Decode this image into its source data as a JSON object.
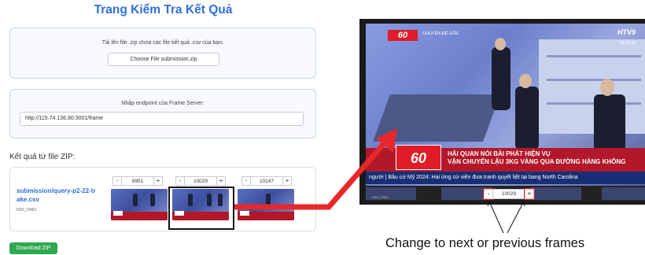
{
  "page": {
    "title": "Trang Kiểm Tra Kết Quả"
  },
  "upload": {
    "label": "Tải lên file .zip chứa các file kết quả .csv của bạn.",
    "file_button": "Choose File submission.zip"
  },
  "endpoint": {
    "label": "Nhập endpoint của Frame Server:",
    "value": "http://115.74.136.80:3001/frame"
  },
  "results": {
    "heading": "Kết quả từ file ZIP:",
    "row": {
      "name": "submission/query-p2-22-tr ake.csv",
      "meta": "K82_V881",
      "frames": [
        {
          "minus": "-",
          "value": "9951",
          "plus": "+"
        },
        {
          "minus": "-",
          "value": "10029",
          "plus": "+"
        },
        {
          "minus": "-",
          "value": "10147",
          "plus": "+"
        }
      ]
    },
    "download_label": "Download ZIP"
  },
  "preview": {
    "channel_badge": "60",
    "channel_name": "CHUYÊN ĐỀ GỐC",
    "clock_logo": "HTV9",
    "clock_time": "06:41:22",
    "news_logo": "60",
    "headline_line1": "HẢI QUAN NÓI BÀI PHÁT HIỆN VỤ",
    "headline_line2": "VẬN CHUYỂN LẬU 3KG VÀNG QUA ĐƯỜNG HÀNG KHÔNG",
    "ticker": "người  |  Bầu cử Mỹ 2024: Hai ứng cử viên đưa tranh quyết liệt tại bang North Carolina",
    "film_caption": "K82_V881",
    "stepper": {
      "minus": "-",
      "value": "10029",
      "plus": "+"
    }
  },
  "annotation": {
    "caption": "Change to next or previous frames"
  },
  "colors": {
    "accent": "#2f6fd6",
    "arrow": "#e8282b",
    "download": "#2fa84f"
  }
}
